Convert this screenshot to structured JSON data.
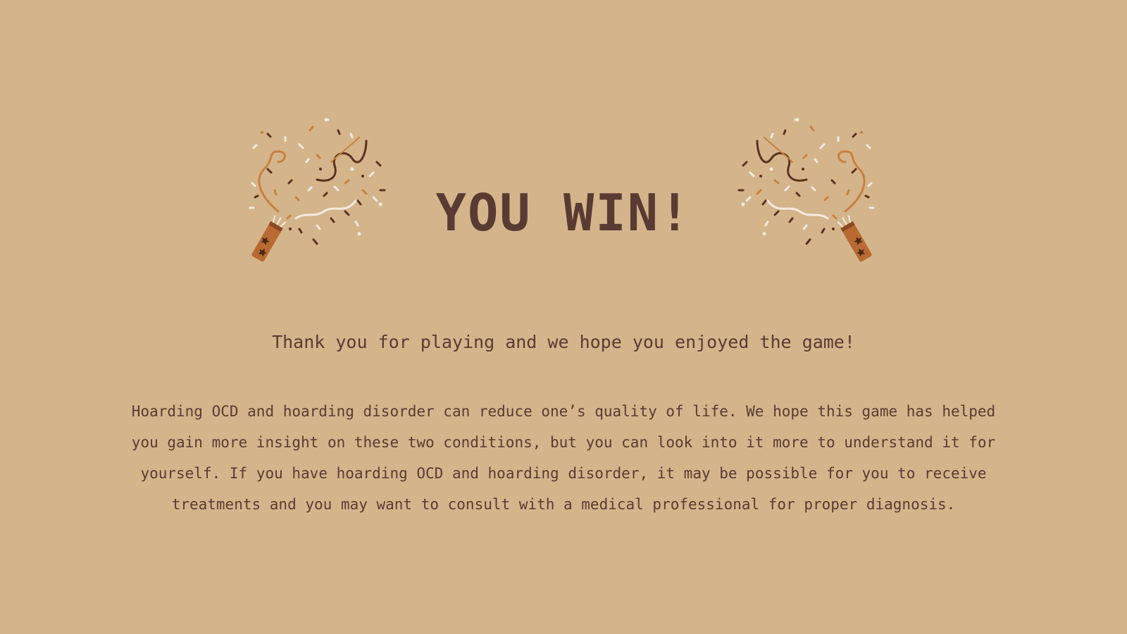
{
  "win_screen": {
    "title": "YOU WIN!",
    "thanks": "Thank you for playing and we hope you enjoyed the game!",
    "message": "Hoarding OCD and hoarding disorder can reduce one’s quality of life. We hope this game has helped you gain more insight on these two conditions, but you can look into it more to understand it for yourself. If you have hoarding OCD and hoarding disorder, it may be possible for you to receive treatments and you may want to consult with a medical professional for proper diagnosis."
  },
  "decor": {
    "left_icon": "party-popper-icon",
    "right_icon": "party-popper-icon"
  },
  "colors": {
    "background": "#d4b48a",
    "text": "#5a3b33",
    "popper_tube": "#b86a32",
    "confetti_dark": "#5a3220",
    "confetti_orange": "#c9803f",
    "confetti_light": "#f3ebe0"
  }
}
